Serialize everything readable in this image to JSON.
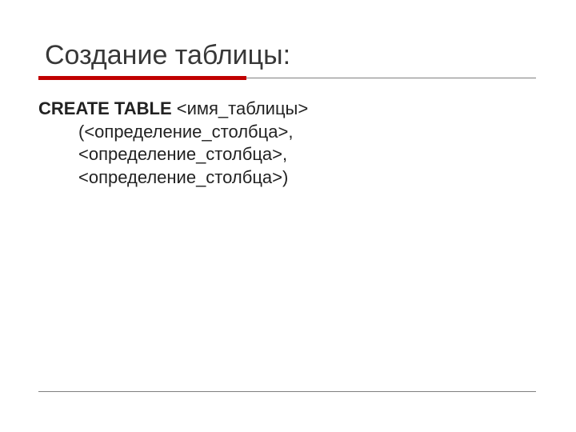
{
  "title": "Создание таблицы:",
  "content": {
    "keyword": "CREATE TABLE",
    "table_name": " <имя_таблицы>",
    "line2": "(<определение_столбца>,",
    "line3": "<определение_столбца>,",
    "line4": "<определение_столбца>)"
  }
}
